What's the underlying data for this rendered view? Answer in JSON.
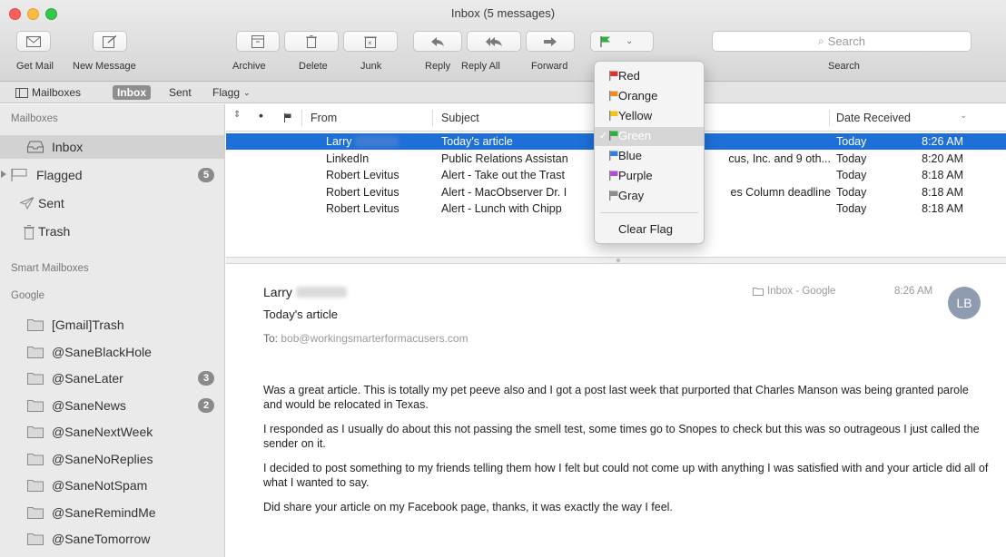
{
  "window": {
    "title": "Inbox (5 messages)"
  },
  "toolbar": {
    "get_mail": "Get Mail",
    "new_message": "New Message",
    "archive": "Archive",
    "delete": "Delete",
    "junk": "Junk",
    "reply": "Reply",
    "reply_all": "Reply All",
    "forward": "Forward",
    "search_placeholder": "Search",
    "search_label": "Search"
  },
  "favorites": {
    "mailboxes": "Mailboxes",
    "inbox": "Inbox",
    "sent": "Sent",
    "flagged": "Flagg"
  },
  "sidebar": {
    "mailboxes_header": "Mailboxes",
    "inbox": "Inbox",
    "flagged": "Flagged",
    "flagged_count": "5",
    "sent": "Sent",
    "trash": "Trash",
    "smart_header": "Smart Mailboxes",
    "google_header": "Google",
    "folders": [
      {
        "label": "[Gmail]Trash",
        "badge": ""
      },
      {
        "label": "@SaneBlackHole",
        "badge": ""
      },
      {
        "label": "@SaneLater",
        "badge": "3"
      },
      {
        "label": "@SaneNews",
        "badge": "2"
      },
      {
        "label": "@SaneNextWeek",
        "badge": ""
      },
      {
        "label": "@SaneNoReplies",
        "badge": ""
      },
      {
        "label": "@SaneNotSpam",
        "badge": ""
      },
      {
        "label": "@SaneRemindMe",
        "badge": ""
      },
      {
        "label": "@SaneTomorrow",
        "badge": ""
      }
    ]
  },
  "list": {
    "columns": {
      "from": "From",
      "subject": "Subject",
      "date": "Date Received"
    },
    "rows": [
      {
        "from": "Larry",
        "subject": "Today's article",
        "date": "Today",
        "time": "8:26 AM"
      },
      {
        "from": "LinkedIn",
        "subject": "Public Relations Assistan",
        "subject_tail": "cus, Inc. and 9 oth...",
        "date": "Today",
        "time": "8:20 AM"
      },
      {
        "from": "Robert Levitus",
        "subject": "Alert - Take out the Trast",
        "subject_tail": "",
        "date": "Today",
        "time": "8:18 AM"
      },
      {
        "from": "Robert Levitus",
        "subject": "Alert - MacObserver Dr. I",
        "subject_tail": "es Column deadline",
        "date": "Today",
        "time": "8:18 AM"
      },
      {
        "from": "Robert Levitus",
        "subject": "Alert - Lunch with Chipp",
        "subject_tail": "",
        "date": "Today",
        "time": "8:18 AM"
      }
    ]
  },
  "flag_menu": {
    "items": [
      {
        "label": "Red",
        "color": "#e0312f"
      },
      {
        "label": "Orange",
        "color": "#f28c1a"
      },
      {
        "label": "Yellow",
        "color": "#f2c318"
      },
      {
        "label": "Green",
        "color": "#2eb03e"
      },
      {
        "label": "Blue",
        "color": "#2f7fe0"
      },
      {
        "label": "Purple",
        "color": "#b54ad6"
      },
      {
        "label": "Gray",
        "color": "#8d8d8d"
      }
    ],
    "clear": "Clear Flag"
  },
  "message": {
    "from": "Larry",
    "subject": "Today's article",
    "to_label": "To:",
    "to": "bob@workingsmarterformacusers.com",
    "mailbox": "Inbox - Google",
    "time": "8:26 AM",
    "avatar": "LB",
    "body": [
      "Was a great article.  This is totally my pet peeve also and I got a post last week that purported that Charles Manson was being granted parole and would be relocated in Texas.",
      "I responded as I usually do about this not passing the smell test, some times go to Snopes to check but this was so outrageous I just called the sender on it.",
      "I decided to post something to my friends telling them how I felt but could not come up with anything I was satisfied with and your article did all of what I wanted to say.",
      "Did share your article on my Facebook page, thanks, it was exactly the way I feel."
    ]
  }
}
